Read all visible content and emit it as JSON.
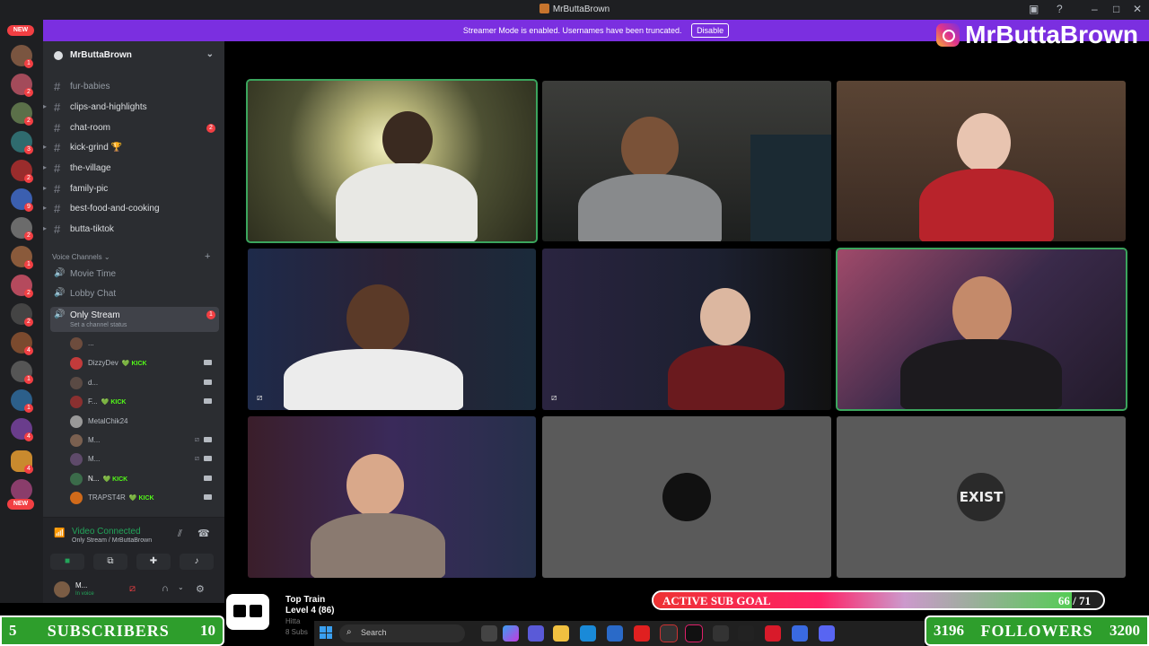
{
  "window": {
    "title": "MrButtaBrown",
    "controls": [
      "minimize-icon",
      "maximize-icon",
      "close-icon"
    ]
  },
  "streamer_mode": {
    "message": "Streamer Mode is enabled. Usernames have been truncated.",
    "disable_label": "Disable"
  },
  "brand": {
    "name": "MrButtaBrown"
  },
  "server_rail": {
    "new_top": "NEW",
    "new_bottom": "NEW"
  },
  "server": {
    "name": "MrButtaBrown"
  },
  "channels": [
    {
      "name": "fur-babies"
    },
    {
      "name": "clips-and-highlights"
    },
    {
      "name": "chat-room",
      "count": "2"
    },
    {
      "name": "kick-grind 🏆"
    },
    {
      "name": "the-village"
    },
    {
      "name": "family-pic"
    },
    {
      "name": "best-food-and-cooking"
    },
    {
      "name": "butta-tiktok"
    }
  ],
  "voice_category": "Voice Channels",
  "voice_channels": [
    {
      "name": "Movie Time"
    },
    {
      "name": "Lobby Chat"
    },
    {
      "name": "Only Stream",
      "status": "Set a channel status",
      "count": "1"
    }
  ],
  "members": [
    {
      "name": "...",
      "kick": ""
    },
    {
      "name": "DizzyDev",
      "kick": "💚 KICK"
    },
    {
      "name": "d...",
      "kick": ""
    },
    {
      "name": "F...",
      "kick": "💚 KICK"
    },
    {
      "name": "MetalChik24",
      "kick": ""
    },
    {
      "name": "M...",
      "kick": ""
    },
    {
      "name": "M...",
      "kick": ""
    },
    {
      "name": "N...",
      "kick": "💚 KICK"
    },
    {
      "name": "TRAPST4R",
      "kick": "💚 KICK"
    }
  ],
  "voice_panel": {
    "title": "Video Connected",
    "subtitle": "Only Stream / MrButtaBrown"
  },
  "user_panel": {
    "name": "M...",
    "status": "In voice"
  },
  "video_tiles": [
    {
      "id": "tile-1",
      "speaking": true
    },
    {
      "id": "tile-2"
    },
    {
      "id": "tile-3"
    },
    {
      "id": "tile-4",
      "muted": true
    },
    {
      "id": "tile-5",
      "muted": true
    },
    {
      "id": "tile-6",
      "speaking": true
    },
    {
      "id": "tile-7"
    },
    {
      "id": "tile-8",
      "avatar_text": ""
    },
    {
      "id": "tile-9",
      "avatar_text": "EXIST"
    }
  ],
  "overlay": {
    "subs_left": "5",
    "subs_label": "SUBSCRIBERS",
    "subs_right": "10",
    "train_title": "Top Train",
    "train_level": "Level 4 (86)",
    "train_faint1": "Hitta",
    "train_faint2": "8 Subs",
    "goal_label": "ACTIVE SUB GOAL",
    "goal_value": "66 / 71",
    "goal_progress": 0.93,
    "followers_left": "3196",
    "followers_label": "FOLLOWERS",
    "followers_right": "3200"
  },
  "taskbar": {
    "search_placeholder": "Search"
  }
}
